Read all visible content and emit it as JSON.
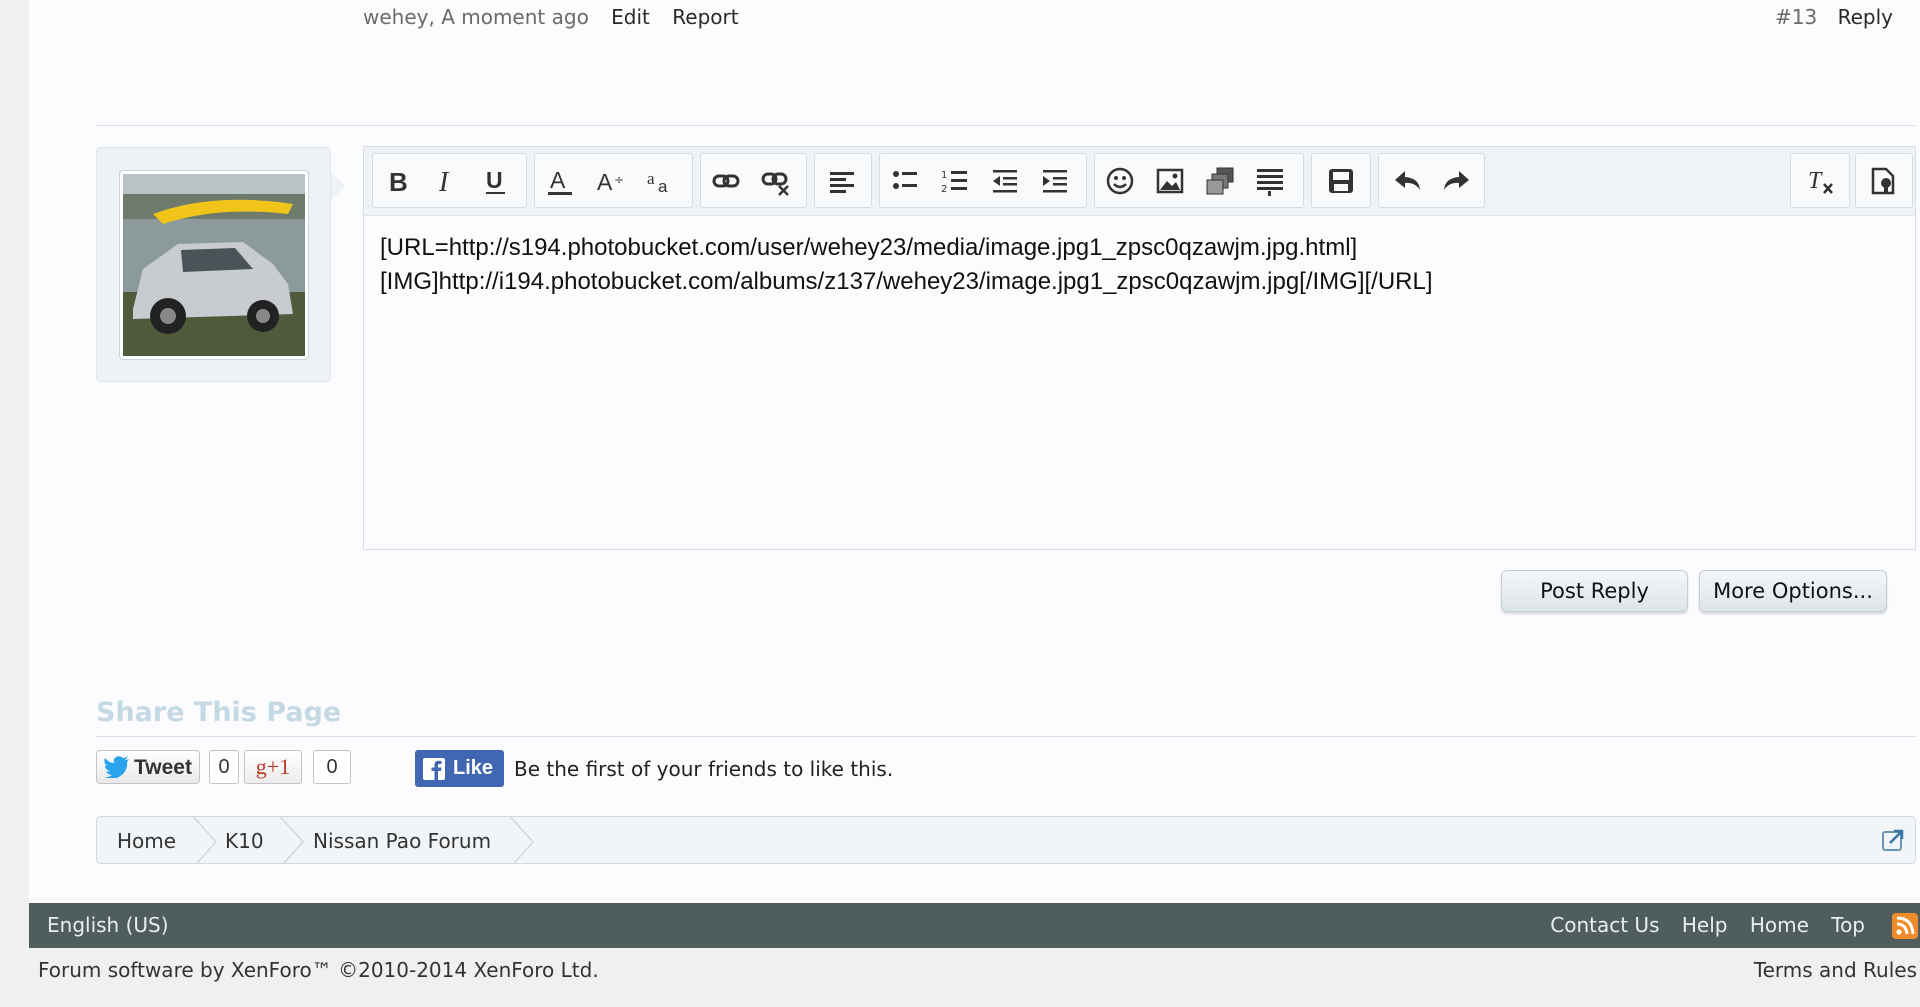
{
  "post": {
    "author_time": "wehey, A moment ago",
    "edit": "Edit",
    "report": "Report",
    "number": "#13",
    "reply": "Reply"
  },
  "editor": {
    "toolbar_icons": [
      "bold-icon",
      "italic-icon",
      "underline-icon",
      "text-color-icon",
      "font-size-icon",
      "font-family-icon",
      "link-icon",
      "unlink-icon",
      "align-icon",
      "bulleted-list-icon",
      "numbered-list-icon",
      "outdent-icon",
      "indent-icon",
      "smilie-icon",
      "image-icon",
      "media-icon",
      "code-icon",
      "save-draft-icon",
      "undo-icon",
      "redo-icon",
      "remove-formatting-icon",
      "toggle-bbcode-icon"
    ],
    "line1": "[URL=http://s194.photobucket.com/user/wehey23/media/image.jpg1_zpsc0qzawjm.jpg.html]",
    "line2": "[IMG]http://i194.photobucket.com/albums/z137/wehey23/image.jpg1_zpsc0qzawjm.jpg[/IMG][/URL]"
  },
  "buttons": {
    "post_reply": "Post Reply",
    "more_options": "More Options..."
  },
  "share": {
    "title": "Share This Page",
    "tweet": "Tweet",
    "tweet_count": "0",
    "gplus": "g+1",
    "gplus_count": "0",
    "like": "Like",
    "like_text": "Be the first of your friends to like this."
  },
  "breadcrumb": {
    "items": [
      "Home",
      "K10",
      "Nissan Pao Forum"
    ]
  },
  "footer": {
    "language": "English (US)",
    "links": [
      "Contact Us",
      "Help",
      "Home",
      "Top"
    ],
    "legal": "Forum software by XenForo™ ©2010-2014 XenForo Ltd.",
    "terms": "Terms and Rules"
  },
  "colors": {
    "footer_bar": "#505d5d",
    "share_title": "#c4d9e4",
    "facebook": "#4267b2",
    "rss": "#f08b2b"
  }
}
